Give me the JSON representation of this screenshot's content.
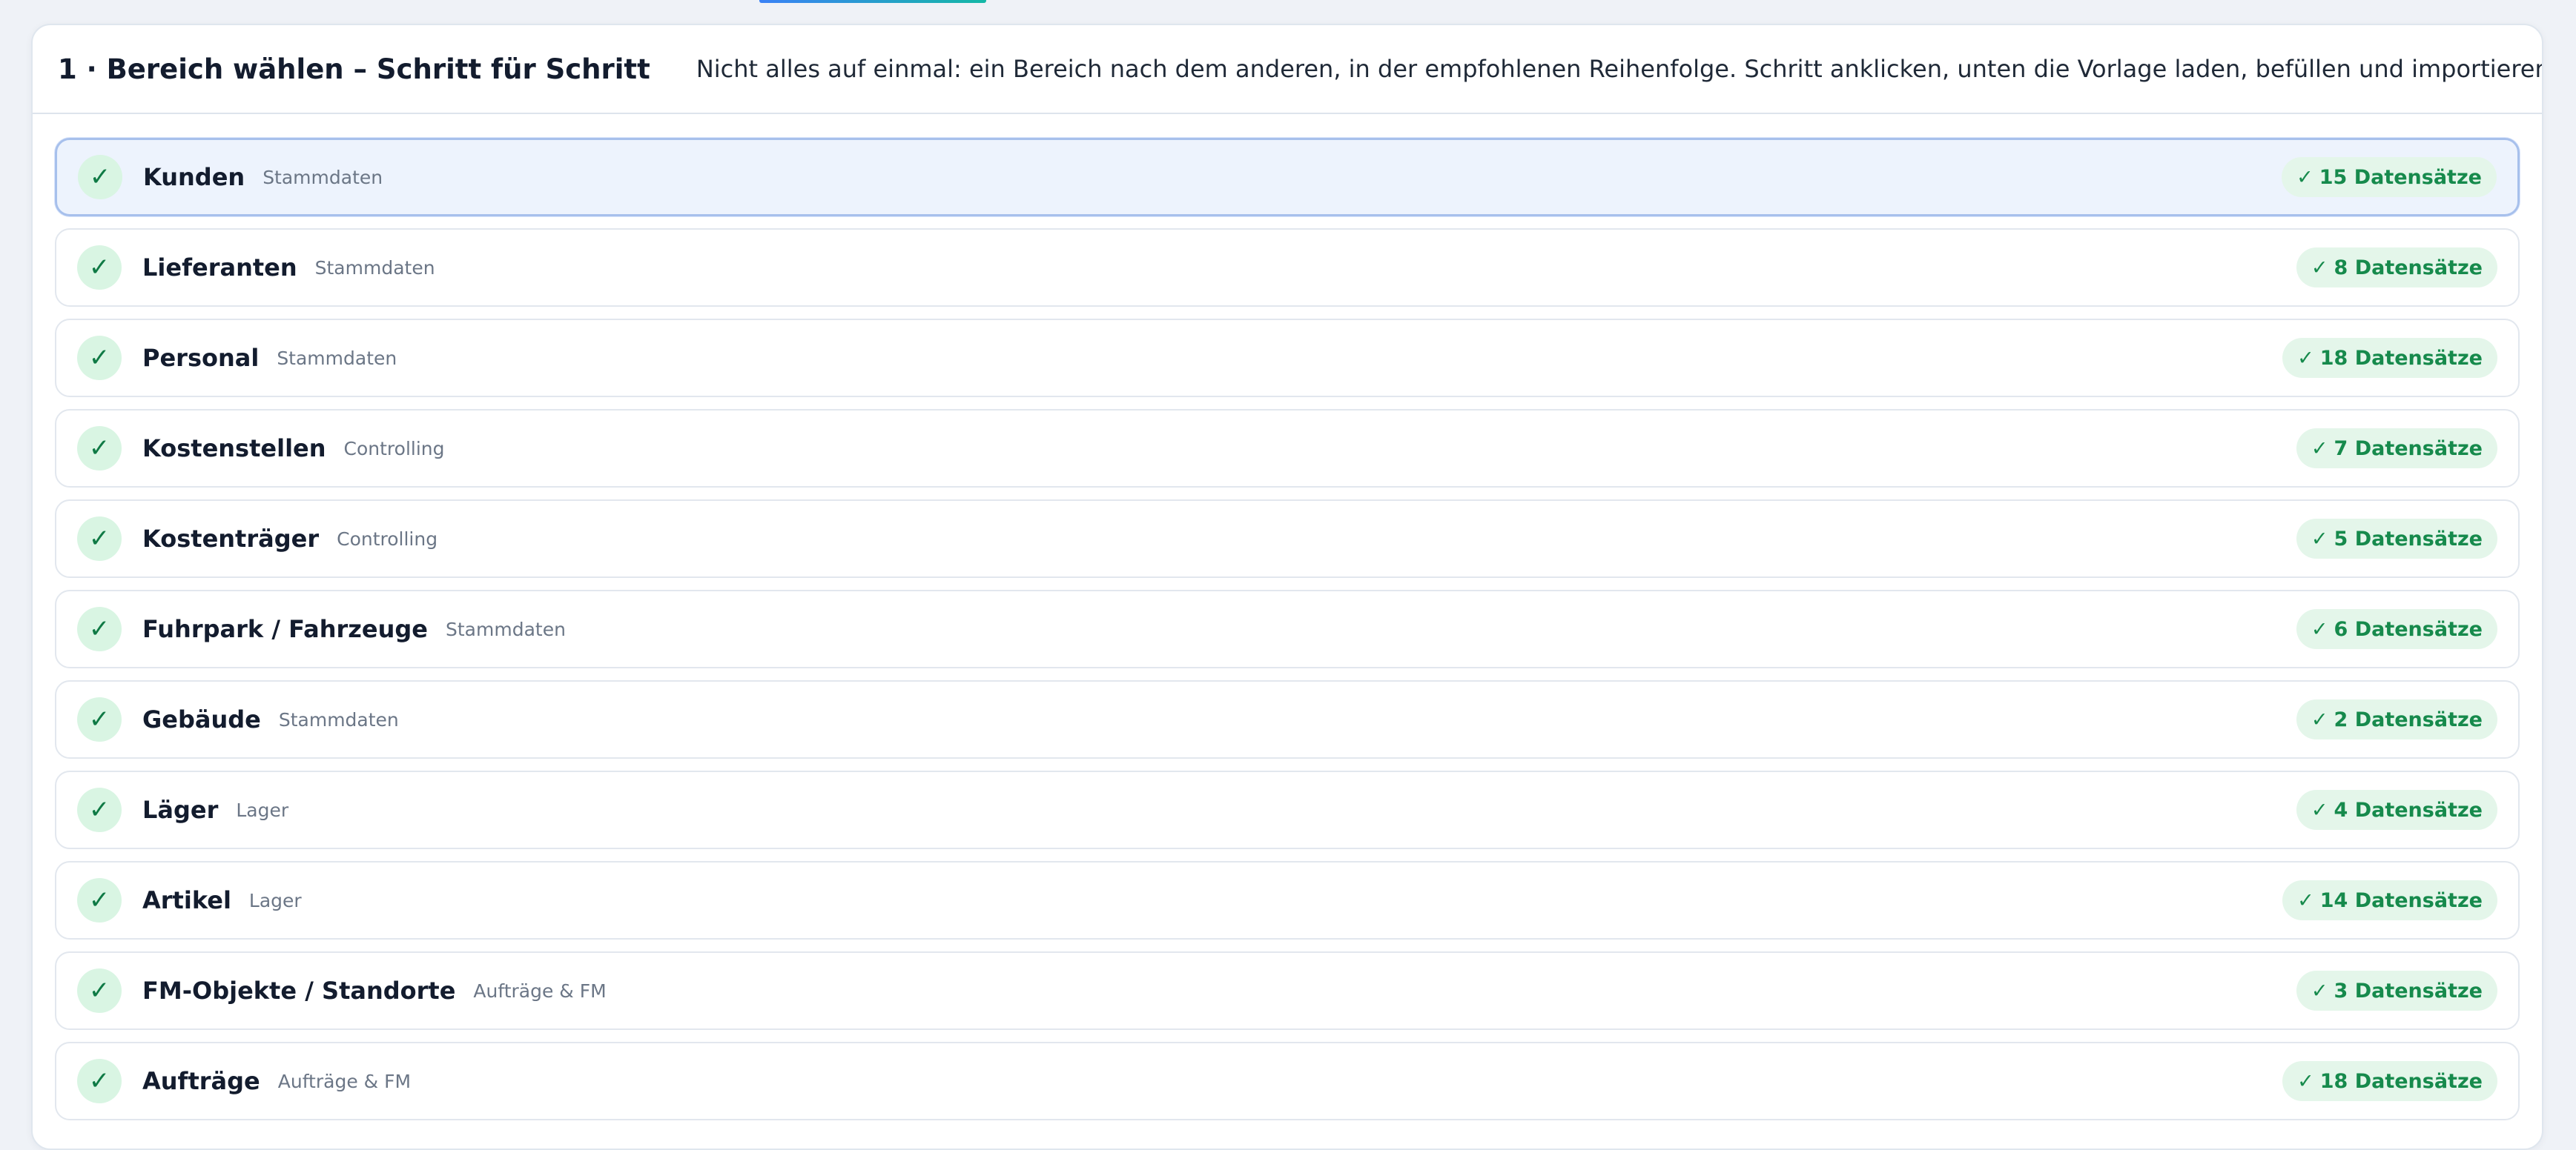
{
  "step": {
    "title": "1 · Bereich wählen – Schritt für Schritt",
    "hint": "Nicht alles auf einmal: ein Bereich nach dem anderen, in der empfohlenen Reihenfolge. Schritt anklicken, unten die Vorlage laden, befüllen und importieren – Erledigtes wird abgehakt."
  },
  "icons": {
    "check": "✓"
  },
  "colors": {
    "done_green": "#168a4c",
    "done_bg": "#e4f6ea",
    "active_bg": "#edf3fd",
    "active_border": "#a7c0ec"
  },
  "areas": [
    {
      "title": "Kunden",
      "category": "Stammdaten",
      "badge": "15 Datensätze",
      "active": true
    },
    {
      "title": "Lieferanten",
      "category": "Stammdaten",
      "badge": "8 Datensätze"
    },
    {
      "title": "Personal",
      "category": "Stammdaten",
      "badge": "18 Datensätze"
    },
    {
      "title": "Kostenstellen",
      "category": "Controlling",
      "badge": "7 Datensätze"
    },
    {
      "title": "Kostenträger",
      "category": "Controlling",
      "badge": "5 Datensätze"
    },
    {
      "title": "Fuhrpark / Fahrzeuge",
      "category": "Stammdaten",
      "badge": "6 Datensätze"
    },
    {
      "title": "Gebäude",
      "category": "Stammdaten",
      "badge": "2 Datensätze"
    },
    {
      "title": "Läger",
      "category": "Lager",
      "badge": "4 Datensätze"
    },
    {
      "title": "Artikel",
      "category": "Lager",
      "badge": "14 Datensätze"
    },
    {
      "title": "FM-Objekte / Standorte",
      "category": "Aufträge & FM",
      "badge": "3 Datensätze"
    },
    {
      "title": "Aufträge",
      "category": "Aufträge & FM",
      "badge": "18 Datensätze"
    }
  ]
}
